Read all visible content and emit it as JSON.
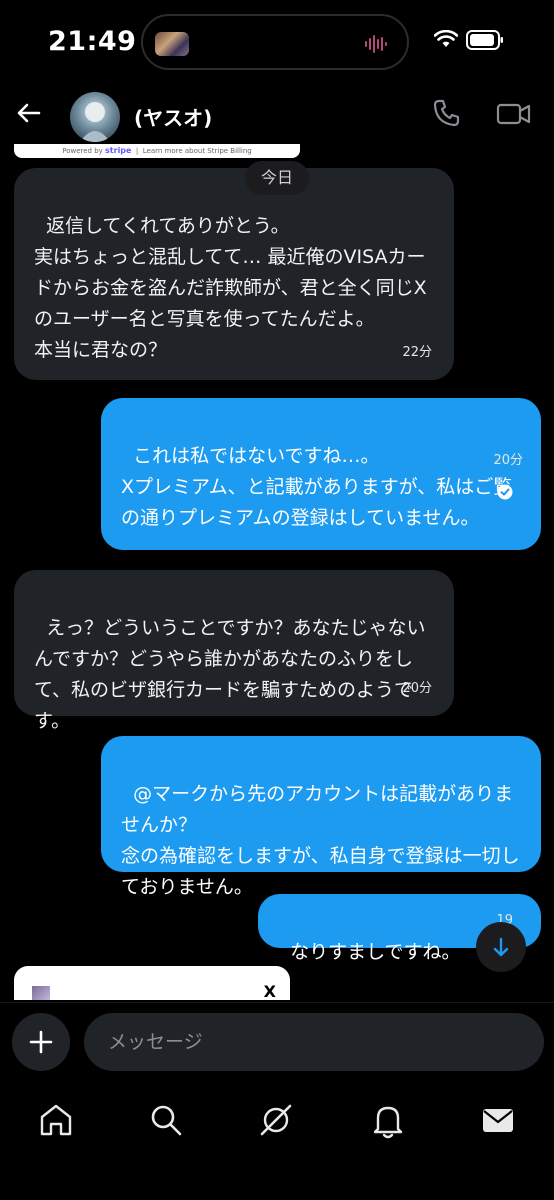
{
  "status_bar": {
    "time": "21:49"
  },
  "header": {
    "contact_name": "(ヤスオ)",
    "stripe_powered": "Powered by",
    "stripe_brand": "stripe",
    "stripe_link": "Learn more about Stripe Billing"
  },
  "date_divider": "今日",
  "messages": [
    {
      "direction": "in",
      "text": "返信してくれてありがとう。\n実はちょっと混乱してて… 最近俺のVISAカードからお金を盗んだ詐欺師が、君と全く同じXのユーザー名と写真を使ってたんだよ。\n本当に君なの？",
      "time": "22分"
    },
    {
      "direction": "out",
      "text": "これは私ではないですね…。\nXプレミアム、と記載がありますが、私はご覧の通りプレミアムの登録はしていません。",
      "time": "20分"
    },
    {
      "direction": "in",
      "text": "えっ？どういうことですか？あなたじゃないんですか？どうやら誰かがあなたのふりをして、私のビザ銀行カードを騙すためのようです。",
      "time": "20分"
    },
    {
      "direction": "out",
      "text": "@マークから先のアカウントは記載がありませんか？\n念の為確認をしますが、私自身で登録は一切しておりません。",
      "time": ""
    },
    {
      "direction": "out",
      "text": "なりすましですね。",
      "time": "19"
    }
  ],
  "link_card": {
    "logo": "X"
  },
  "composer": {
    "placeholder": "メッセージ"
  },
  "colors": {
    "outgoing_bubble": "#1d9bf0",
    "incoming_bubble": "#202327",
    "background": "#000000"
  },
  "nav": [
    "home-icon",
    "search-icon",
    "grok-icon",
    "notifications-icon",
    "messages-icon"
  ]
}
